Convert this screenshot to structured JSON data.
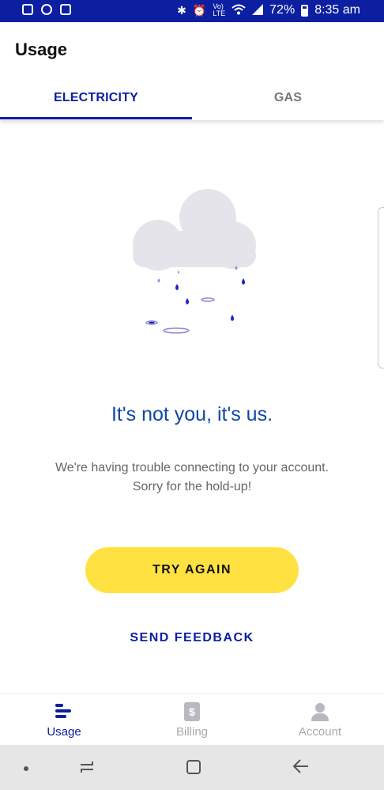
{
  "status_bar": {
    "battery": "72%",
    "time": "8:35 am",
    "battery_level": 0.72,
    "icons": [
      "speaker-icon",
      "iheart-icon",
      "checkbox-icon",
      "bluetooth-icon",
      "alarm-icon",
      "volte-icon",
      "wifi-icon",
      "signal-icon",
      "battery-icon"
    ]
  },
  "header": {
    "title": "Usage"
  },
  "tabs": [
    {
      "label": "ELECTRICITY",
      "selected": true
    },
    {
      "label": "GAS",
      "selected": false
    }
  ],
  "error": {
    "headline": "It's not you, it's us.",
    "message_line1": "We're having trouble connecting to your account.",
    "message_line2": "Sorry for the hold-up!",
    "illustration": "rain-cloud-icon"
  },
  "actions": {
    "try_again": "TRY AGAIN",
    "send_feedback": "SEND FEEDBACK"
  },
  "bottom_nav": [
    {
      "label": "Usage",
      "icon": "usage-bars-icon",
      "selected": true
    },
    {
      "label": "Billing",
      "icon": "dollar-icon",
      "selected": false
    },
    {
      "label": "Account",
      "icon": "person-icon",
      "selected": false
    }
  ],
  "colors": {
    "brand_blue": "#0b1fa0",
    "headline_blue": "#0d47a8",
    "button_yellow": "#ffe242",
    "cloud_gray": "#e4e4ea",
    "rain_blue": "#1e22c8"
  }
}
